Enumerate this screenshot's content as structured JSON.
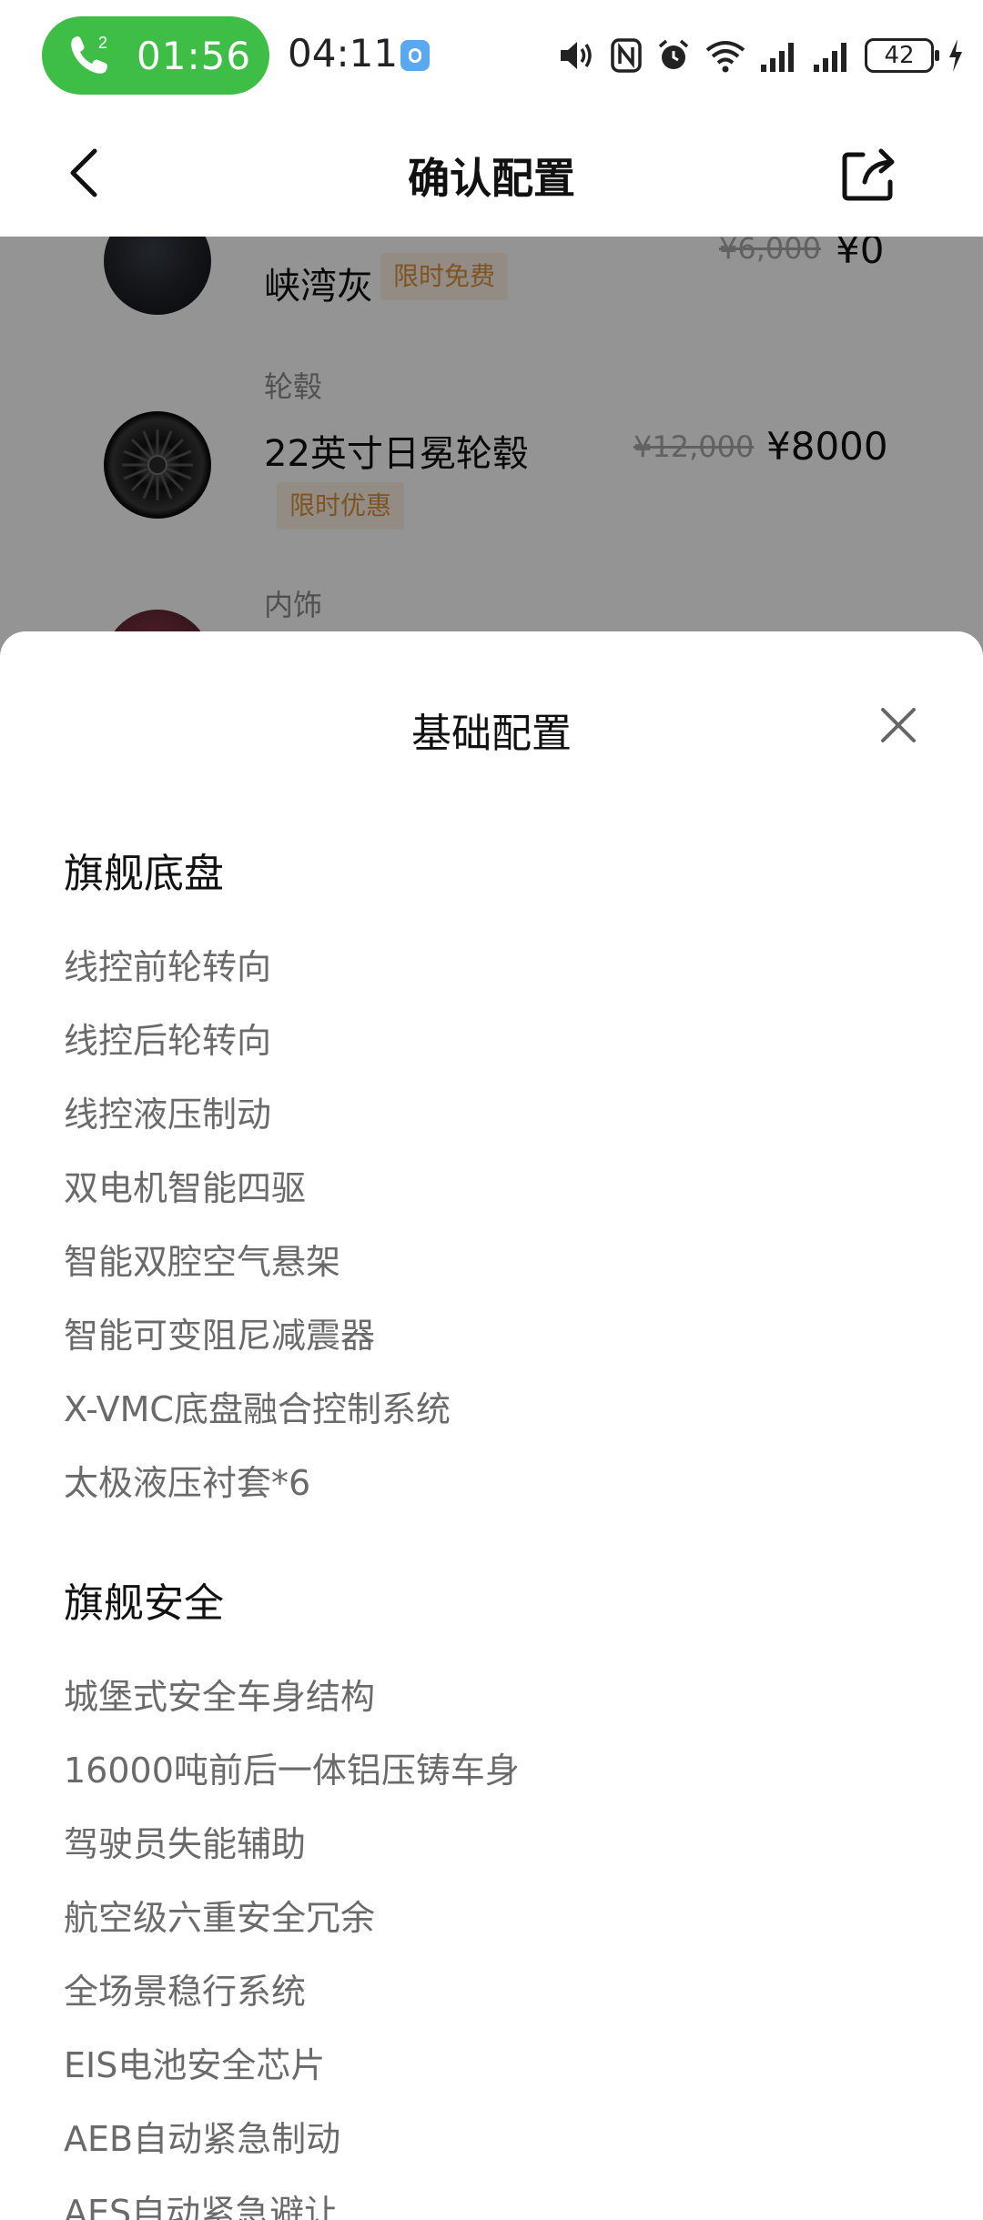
{
  "status_bar": {
    "call_timer": "01:56",
    "call_lines": "2",
    "clock": "04:11",
    "battery": "42",
    "pill_color": "#3ebe46"
  },
  "nav": {
    "title": "确认配置",
    "back_icon": "chevron-left-icon",
    "share_icon": "share-icon"
  },
  "options": [
    {
      "category": "",
      "name": "峡湾灰",
      "tag": "限时免费",
      "old_price": "¥6,000",
      "price": "¥0",
      "thumb": "dark-gray-swatch"
    },
    {
      "category": "轮毂",
      "name": "22英寸日冕轮毂",
      "tag": "限时优惠",
      "old_price": "¥12,000",
      "price": "¥8000",
      "thumb": "wheel"
    },
    {
      "category": "内饰",
      "name": "",
      "tag": "",
      "old_price": "",
      "price": "",
      "thumb": "maroon-swatch"
    }
  ],
  "sheet": {
    "title": "基础配置",
    "close_icon": "close-icon",
    "sections": [
      {
        "title": "旗舰底盘",
        "items": [
          "线控前轮转向",
          "线控后轮转向",
          "线控液压制动",
          "双电机智能四驱",
          "智能双腔空气悬架",
          "智能可变阻尼减震器",
          "X-VMC底盘融合控制系统",
          "太极液压衬套*6"
        ]
      },
      {
        "title": "旗舰安全",
        "items": [
          "城堡式安全车身结构",
          "16000吨前后一体铝压铸车身",
          "驾驶员失能辅助",
          "航空级六重安全冗余",
          "全场景稳行系统",
          "EIS电池安全芯片",
          "AEB自动紧急制动",
          "AES自动紧急避让"
        ]
      }
    ]
  }
}
